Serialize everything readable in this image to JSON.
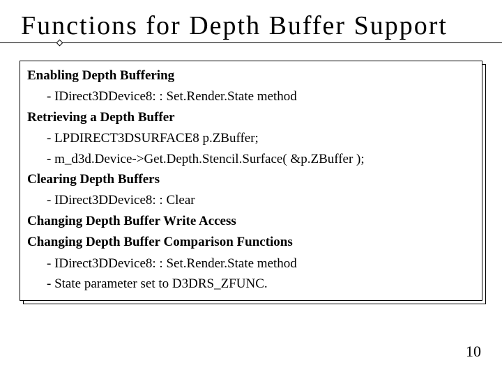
{
  "title": "Functions for Depth Buffer Support",
  "sections": {
    "s0": {
      "heading": "Enabling Depth Buffering",
      "item0": "- IDirect3DDevice8: : Set.Render.State method"
    },
    "s1": {
      "heading": "Retrieving a Depth Buffer",
      "item0": "- LPDIRECT3DSURFACE8 p.ZBuffer;",
      "item1": "- m_d3d.Device->Get.Depth.Stencil.Surface( &p.ZBuffer );"
    },
    "s2": {
      "heading": "Clearing Depth Buffers",
      "item0": "- IDirect3DDevice8: : Clear"
    },
    "s3": {
      "heading": "Changing Depth Buffer Write Access"
    },
    "s4": {
      "heading": "Changing Depth Buffer Comparison Functions",
      "item0": "- IDirect3DDevice8: : Set.Render.State method",
      "item1": "- State parameter set to D3DRS_ZFUNC."
    }
  },
  "page_number": "10"
}
